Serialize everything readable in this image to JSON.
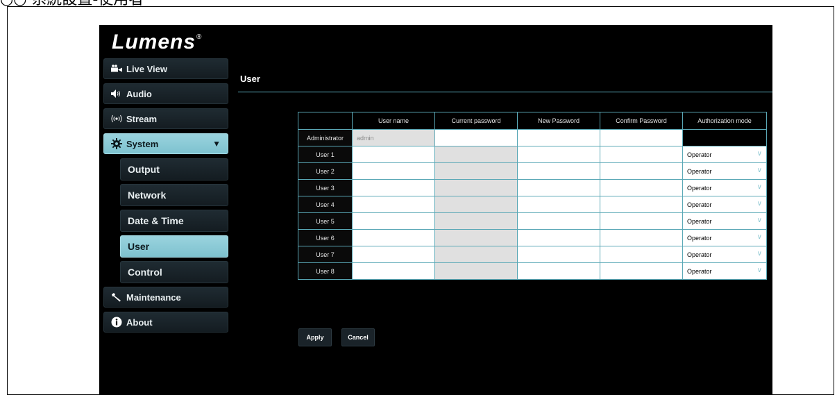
{
  "doc": {
    "heading": "○○ 系統設置-使用者"
  },
  "app": {
    "logo": "Lumens",
    "trademark": "®"
  },
  "sidebar": {
    "items": [
      {
        "label": "Live View",
        "icon": "video-camera-icon"
      },
      {
        "label": "Audio",
        "icon": "speaker-icon"
      },
      {
        "label": "Stream",
        "icon": "broadcast-icon"
      },
      {
        "label": "System",
        "icon": "gear-icon",
        "caret": "▼"
      },
      {
        "label": "Output"
      },
      {
        "label": "Network"
      },
      {
        "label": "Date & Time"
      },
      {
        "label": "User"
      },
      {
        "label": "Control"
      },
      {
        "label": "Maintenance",
        "icon": "wrench-icon"
      },
      {
        "label": "About",
        "icon": "info-icon"
      }
    ]
  },
  "page": {
    "title": "User"
  },
  "table": {
    "headers": [
      "",
      "User name",
      "Current password",
      "New Password",
      "Confirm Password",
      "Authorization mode"
    ],
    "admin": {
      "label": "Administrator",
      "username": "admin"
    },
    "users": [
      {
        "label": "User 1",
        "mode": "Operator"
      },
      {
        "label": "User 2",
        "mode": "Operator"
      },
      {
        "label": "User 3",
        "mode": "Operator"
      },
      {
        "label": "User 4",
        "mode": "Operator"
      },
      {
        "label": "User 5",
        "mode": "Operator"
      },
      {
        "label": "User 6",
        "mode": "Operator"
      },
      {
        "label": "User 7",
        "mode": "Operator"
      },
      {
        "label": "User 8",
        "mode": "Operator"
      }
    ],
    "chevron": "∨"
  },
  "buttons": {
    "apply": "Apply",
    "cancel": "Cancel"
  },
  "colors": {
    "accent": "#7ec2cf",
    "border": "#5aa8b6",
    "background": "#000000"
  }
}
